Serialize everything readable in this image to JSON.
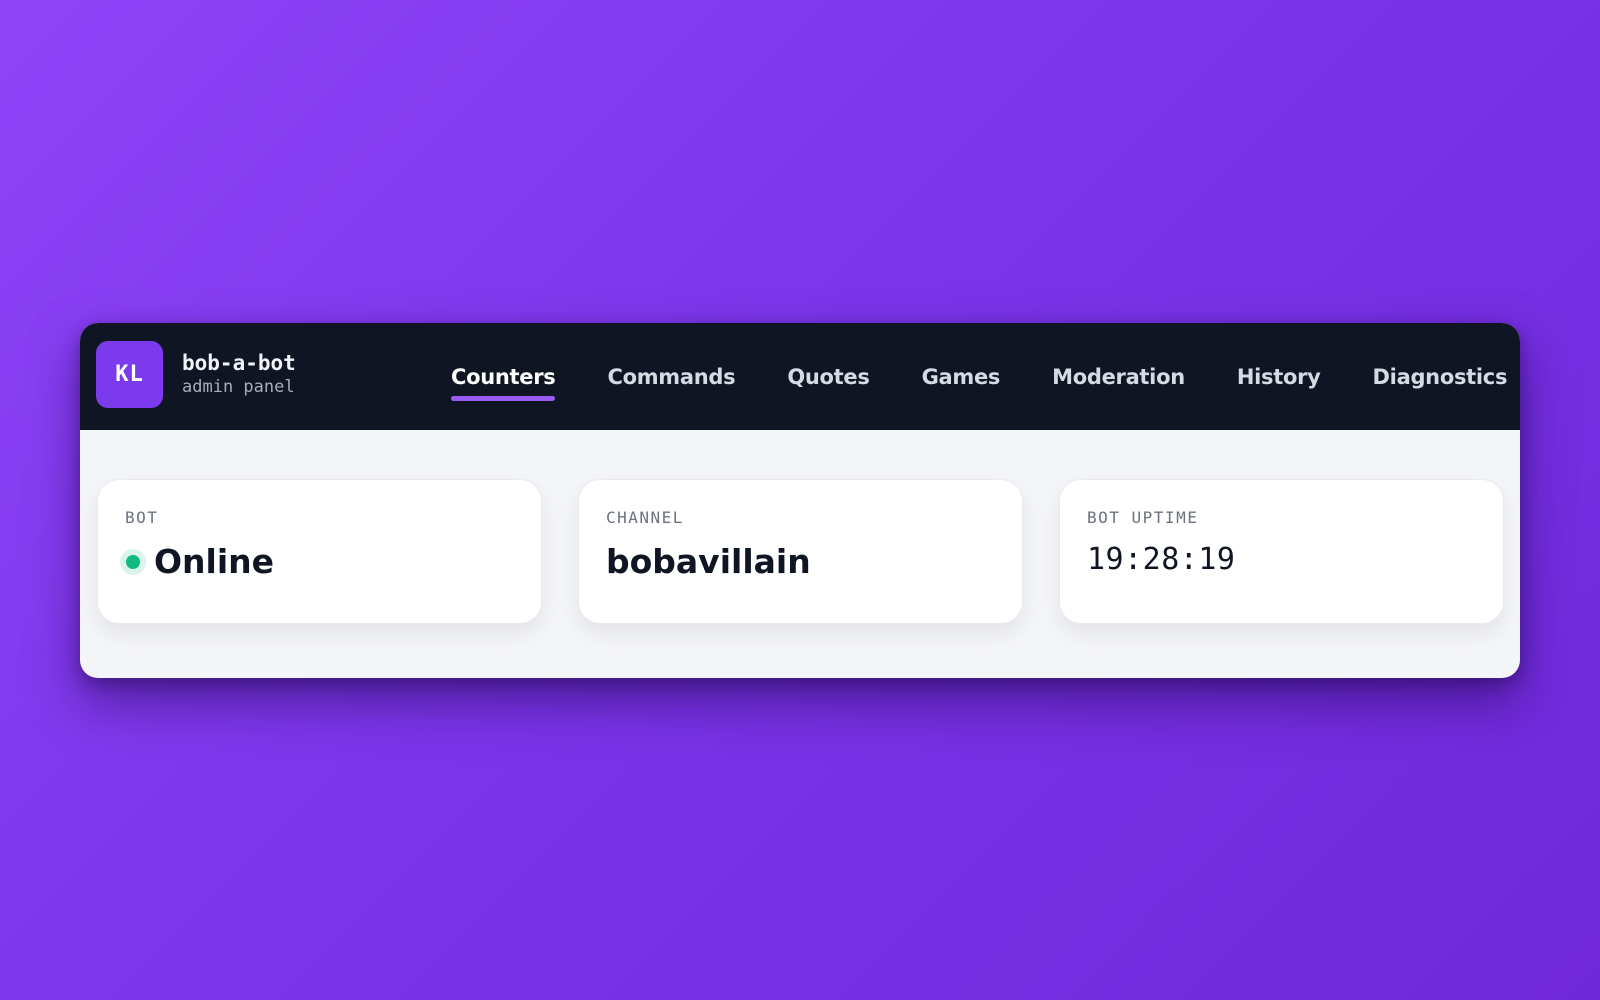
{
  "brand": {
    "initials": "KL",
    "name": "bob-a-bot",
    "subtitle": "admin panel"
  },
  "nav": {
    "active": "Counters",
    "items": [
      {
        "label": "Counters"
      },
      {
        "label": "Commands"
      },
      {
        "label": "Quotes"
      },
      {
        "label": "Games"
      },
      {
        "label": "Moderation"
      },
      {
        "label": "History"
      },
      {
        "label": "Diagnostics"
      }
    ]
  },
  "cards": {
    "bot": {
      "label": "BOT",
      "value": "Online",
      "status_color": "#10b981"
    },
    "channel": {
      "label": "CHANNEL",
      "value": "bobavillain"
    },
    "uptime": {
      "label": "BOT UPTIME",
      "value": "19:28:19"
    }
  },
  "colors": {
    "accent": "#7c3aed",
    "topbar": "#0f1523",
    "active_underline": "#9b5cf6",
    "online": "#10b981"
  }
}
